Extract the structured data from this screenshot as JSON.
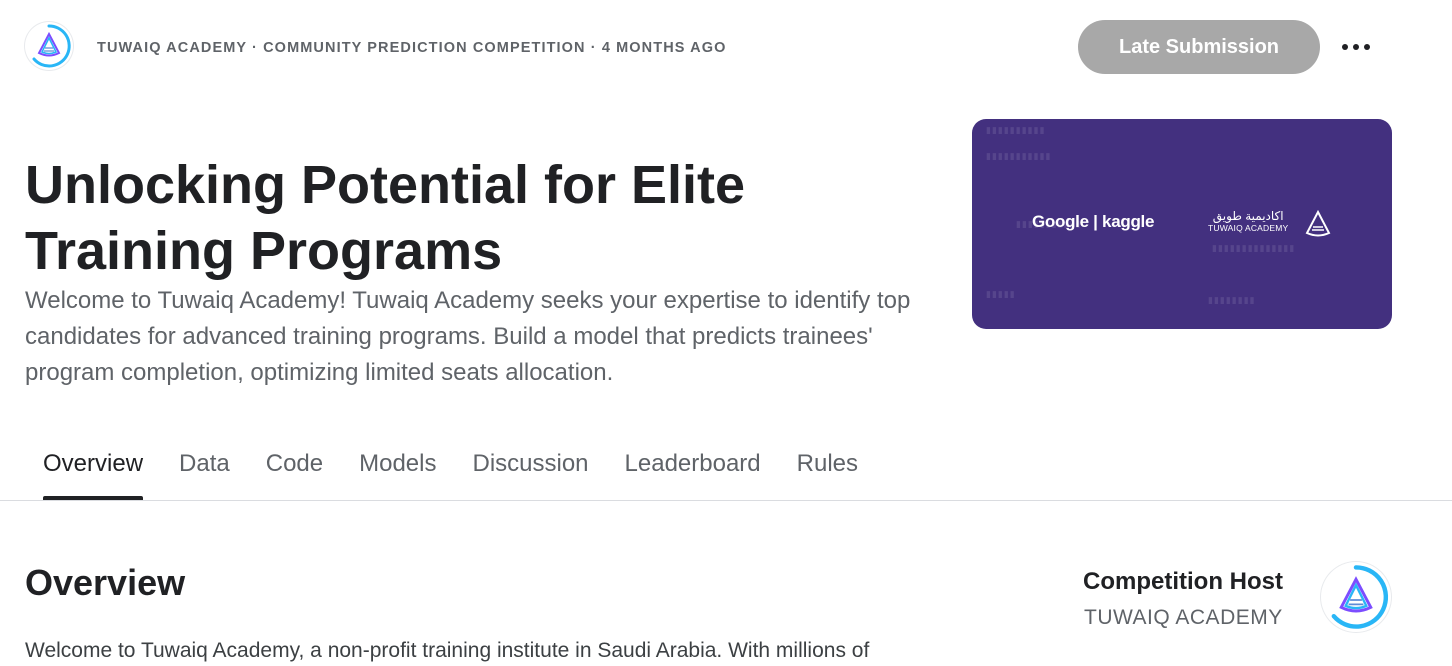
{
  "header": {
    "meta": "TUWAIQ ACADEMY · COMMUNITY PREDICTION COMPETITION · 4 MONTHS AGO",
    "late_submission_label": "Late Submission",
    "host_logo_icon": "tuwaiq-academy-logo-icon",
    "more_icon": "more-horizontal-icon"
  },
  "hero": {
    "title": "Unlocking Potential for Elite Training Programs",
    "description": "Welcome to Tuwaiq Academy! Tuwaiq Academy seeks your expertise to identify top candidates for advanced training programs. Build a model that predicts trainees' program completion, optimizing limited seats allocation.",
    "banner": {
      "partner_text": "Google | kaggle",
      "academy_arabic": "اكاديمية طويق",
      "academy_english": "TUWAIQ ACADEMY",
      "background_color": "#43307f"
    }
  },
  "tabs": [
    {
      "label": "Overview",
      "active": true
    },
    {
      "label": "Data",
      "active": false
    },
    {
      "label": "Code",
      "active": false
    },
    {
      "label": "Models",
      "active": false
    },
    {
      "label": "Discussion",
      "active": false
    },
    {
      "label": "Leaderboard",
      "active": false
    },
    {
      "label": "Rules",
      "active": false
    }
  ],
  "overview": {
    "heading": "Overview",
    "body": "Welcome to Tuwaiq Academy, a non-profit training institute in Saudi Arabia. With millions of"
  },
  "sidebar": {
    "host_label": "Competition Host",
    "host_name": "TUWAIQ ACADEMY"
  },
  "colors": {
    "accent_ring": "#29b6f6",
    "accent_purple": "#7c4dff",
    "button_disabled": "#a8a8a8",
    "text_primary": "#202124",
    "text_secondary": "#5f6368"
  }
}
